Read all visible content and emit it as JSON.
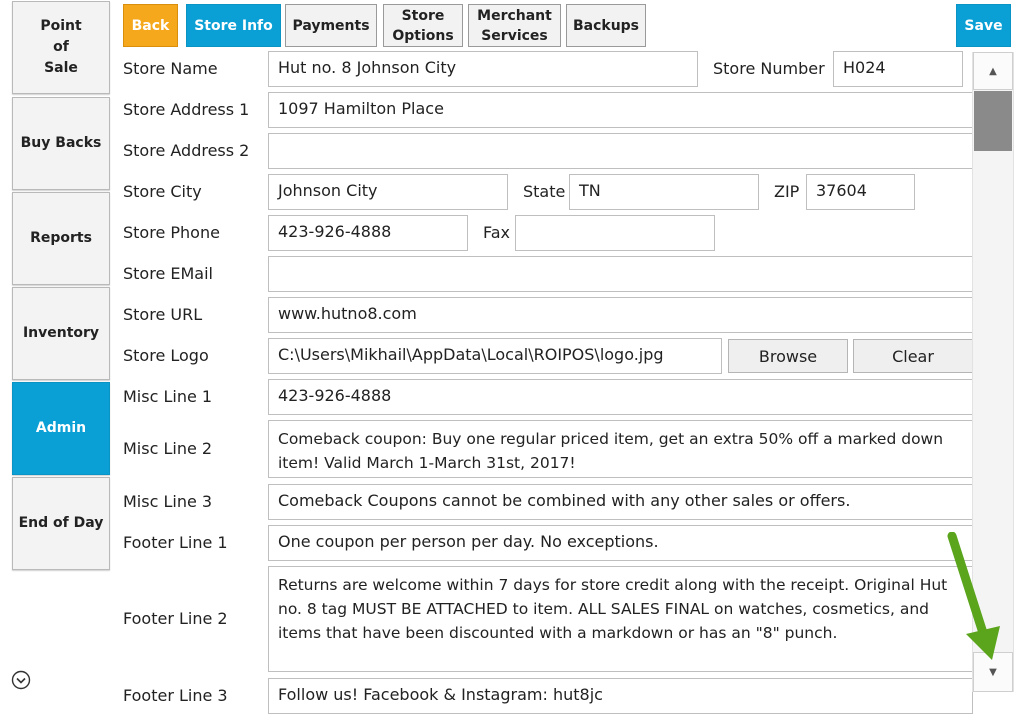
{
  "sidebar": {
    "items": [
      {
        "label": "Point\nof\nSale"
      },
      {
        "label": "Buy Backs"
      },
      {
        "label": "Reports"
      },
      {
        "label": "Inventory"
      },
      {
        "label": "Admin"
      },
      {
        "label": "End of Day"
      }
    ]
  },
  "toolbar": {
    "back": "Back",
    "store_info": "Store Info",
    "payments": "Payments",
    "store_options": "Store\nOptions",
    "merchant_services": "Merchant\nServices",
    "backups": "Backups",
    "save": "Save"
  },
  "form": {
    "store_name": {
      "label": "Store Name",
      "value": "Hut no. 8 Johnson City"
    },
    "store_number": {
      "label": "Store Number",
      "value": "H024"
    },
    "address1": {
      "label": "Store Address 1",
      "value": "1097 Hamilton Place"
    },
    "address2": {
      "label": "Store Address 2",
      "value": ""
    },
    "city": {
      "label": "Store City",
      "value": "Johnson City"
    },
    "state": {
      "label": "State",
      "value": "TN"
    },
    "zip": {
      "label": "ZIP",
      "value": "37604"
    },
    "phone": {
      "label": "Store Phone",
      "value": "423-926-4888"
    },
    "fax": {
      "label": "Fax",
      "value": ""
    },
    "email": {
      "label": "Store EMail",
      "value": ""
    },
    "url": {
      "label": "Store URL",
      "value": "www.hutno8.com"
    },
    "logo": {
      "label": "Store Logo",
      "value": "C:\\Users\\Mikhail\\AppData\\Local\\ROIPOS\\logo.jpg",
      "browse": "Browse",
      "clear": "Clear"
    },
    "misc1": {
      "label": "Misc Line 1",
      "value": "423-926-4888"
    },
    "misc2": {
      "label": "Misc Line 2",
      "value": "Comeback coupon: Buy one regular priced item, get an extra 50% off a marked down item! Valid March 1-March 31st, 2017!"
    },
    "misc3": {
      "label": "Misc Line 3",
      "value": "Comeback Coupons cannot be combined with any other sales or offers."
    },
    "footer1": {
      "label": "Footer Line 1",
      "value": "One coupon per person per day. No exceptions."
    },
    "footer2": {
      "label": "Footer Line 2",
      "value": "Returns are welcome within 7 days for store credit along with the receipt. Original Hut no. 8 tag MUST BE ATTACHED to item.  ALL SALES FINAL on watches, cosmetics, and items that have been discounted with a markdown or has an \"8\" punch."
    },
    "footer3": {
      "label": "Footer Line 3",
      "value": "Follow us! Facebook & Instagram: hut8jc"
    }
  },
  "icons": {
    "scroll_up": "triangle-up-icon",
    "scroll_down": "triangle-down-icon",
    "expand": "chevron-circle-down-icon",
    "annotation": "green-arrow-icon"
  },
  "colors": {
    "accent": "#0aa0d6",
    "back": "#f5a81c",
    "arrow": "#5aa51c",
    "scroll_thumb": "#8a8a8a"
  }
}
